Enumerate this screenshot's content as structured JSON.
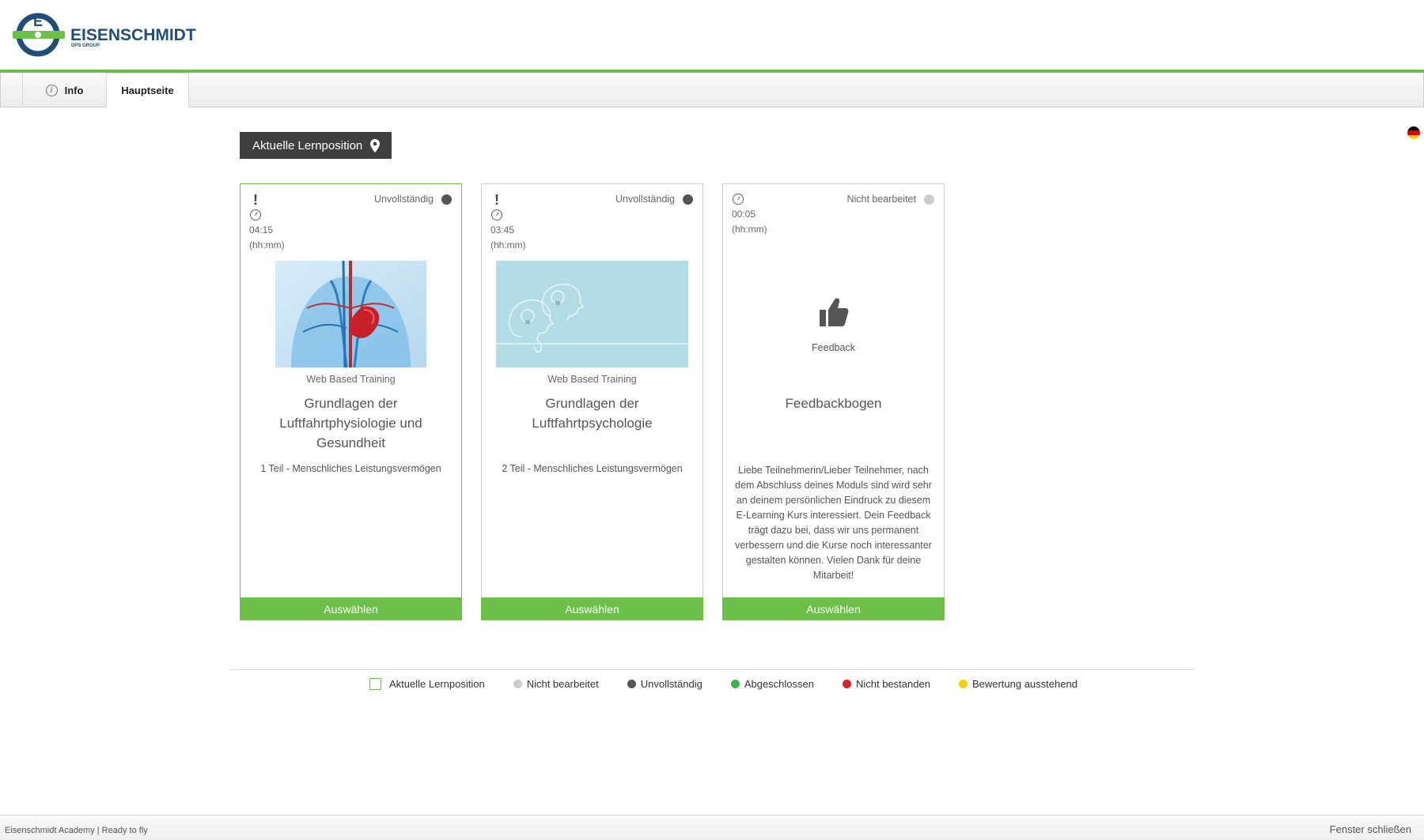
{
  "header": {
    "logo_text": "EISENSCHMIDT",
    "logo_subtext": "DPS GROUP",
    "accent_color": "#6cc04a",
    "brand_color": "#1f4e79"
  },
  "tabs": [
    {
      "label": "Info",
      "icon": "info-icon"
    },
    {
      "label": "Hauptseite"
    }
  ],
  "language_flag": "germany-flag-icon",
  "position_button": {
    "label": "Aktuelle Lernposition",
    "icon": "location-pin-icon"
  },
  "cards": [
    {
      "time": "04:15",
      "time_unit": "(hh:mm)",
      "status": "Unvollständig",
      "status_color": "#555555",
      "type": "Web Based Training",
      "title": "Grundlagen der Luftfahrtphysiologie und Gesundheit",
      "subtitle": "1 Teil - Menschliches Leistungsvermögen",
      "button": "Auswählen",
      "current": true
    },
    {
      "time": "03:45",
      "time_unit": "(hh:mm)",
      "status": "Unvollständig",
      "status_color": "#555555",
      "type": "Web Based Training",
      "title": "Grundlagen der Luftfahrtpsychologie",
      "subtitle": "2 Teil - Menschliches Leistungsvermögen",
      "button": "Auswählen",
      "current": false
    },
    {
      "time": "00:05",
      "time_unit": "(hh:mm)",
      "status": "Nicht bearbeitet",
      "status_color": "#cccccc",
      "type": "Feedback",
      "title": "Feedbackbogen",
      "description": "Liebe Teilnehmerin/Lieber Teilnehmer, nach dem Abschluss deines Moduls sind wird sehr an deinem persönlichen Eindruck zu diesem E-Learning Kurs interessiert. Dein Feedback trägt dazu bei, dass wir uns permanent verbessern und die Kurse noch interessanter gestalten können. Vielen Dank für deine Mitarbeit!",
      "button": "Auswählen",
      "current": false
    }
  ],
  "legend": [
    {
      "label": "Aktuelle Lernposition",
      "color": "#6cc04a"
    },
    {
      "label": "Nicht bearbeitet",
      "color": "#cccccc"
    },
    {
      "label": "Unvollständig",
      "color": "#555555"
    },
    {
      "label": "Abgeschlossen",
      "color": "#3cb54a"
    },
    {
      "label": "Nicht bestanden",
      "color": "#e02020"
    },
    {
      "label": "Bewertung ausstehend",
      "color": "#f5d000"
    }
  ],
  "footer": {
    "left": "Eisenschmidt Academy | Ready to fly",
    "right": "Fenster schließen"
  }
}
